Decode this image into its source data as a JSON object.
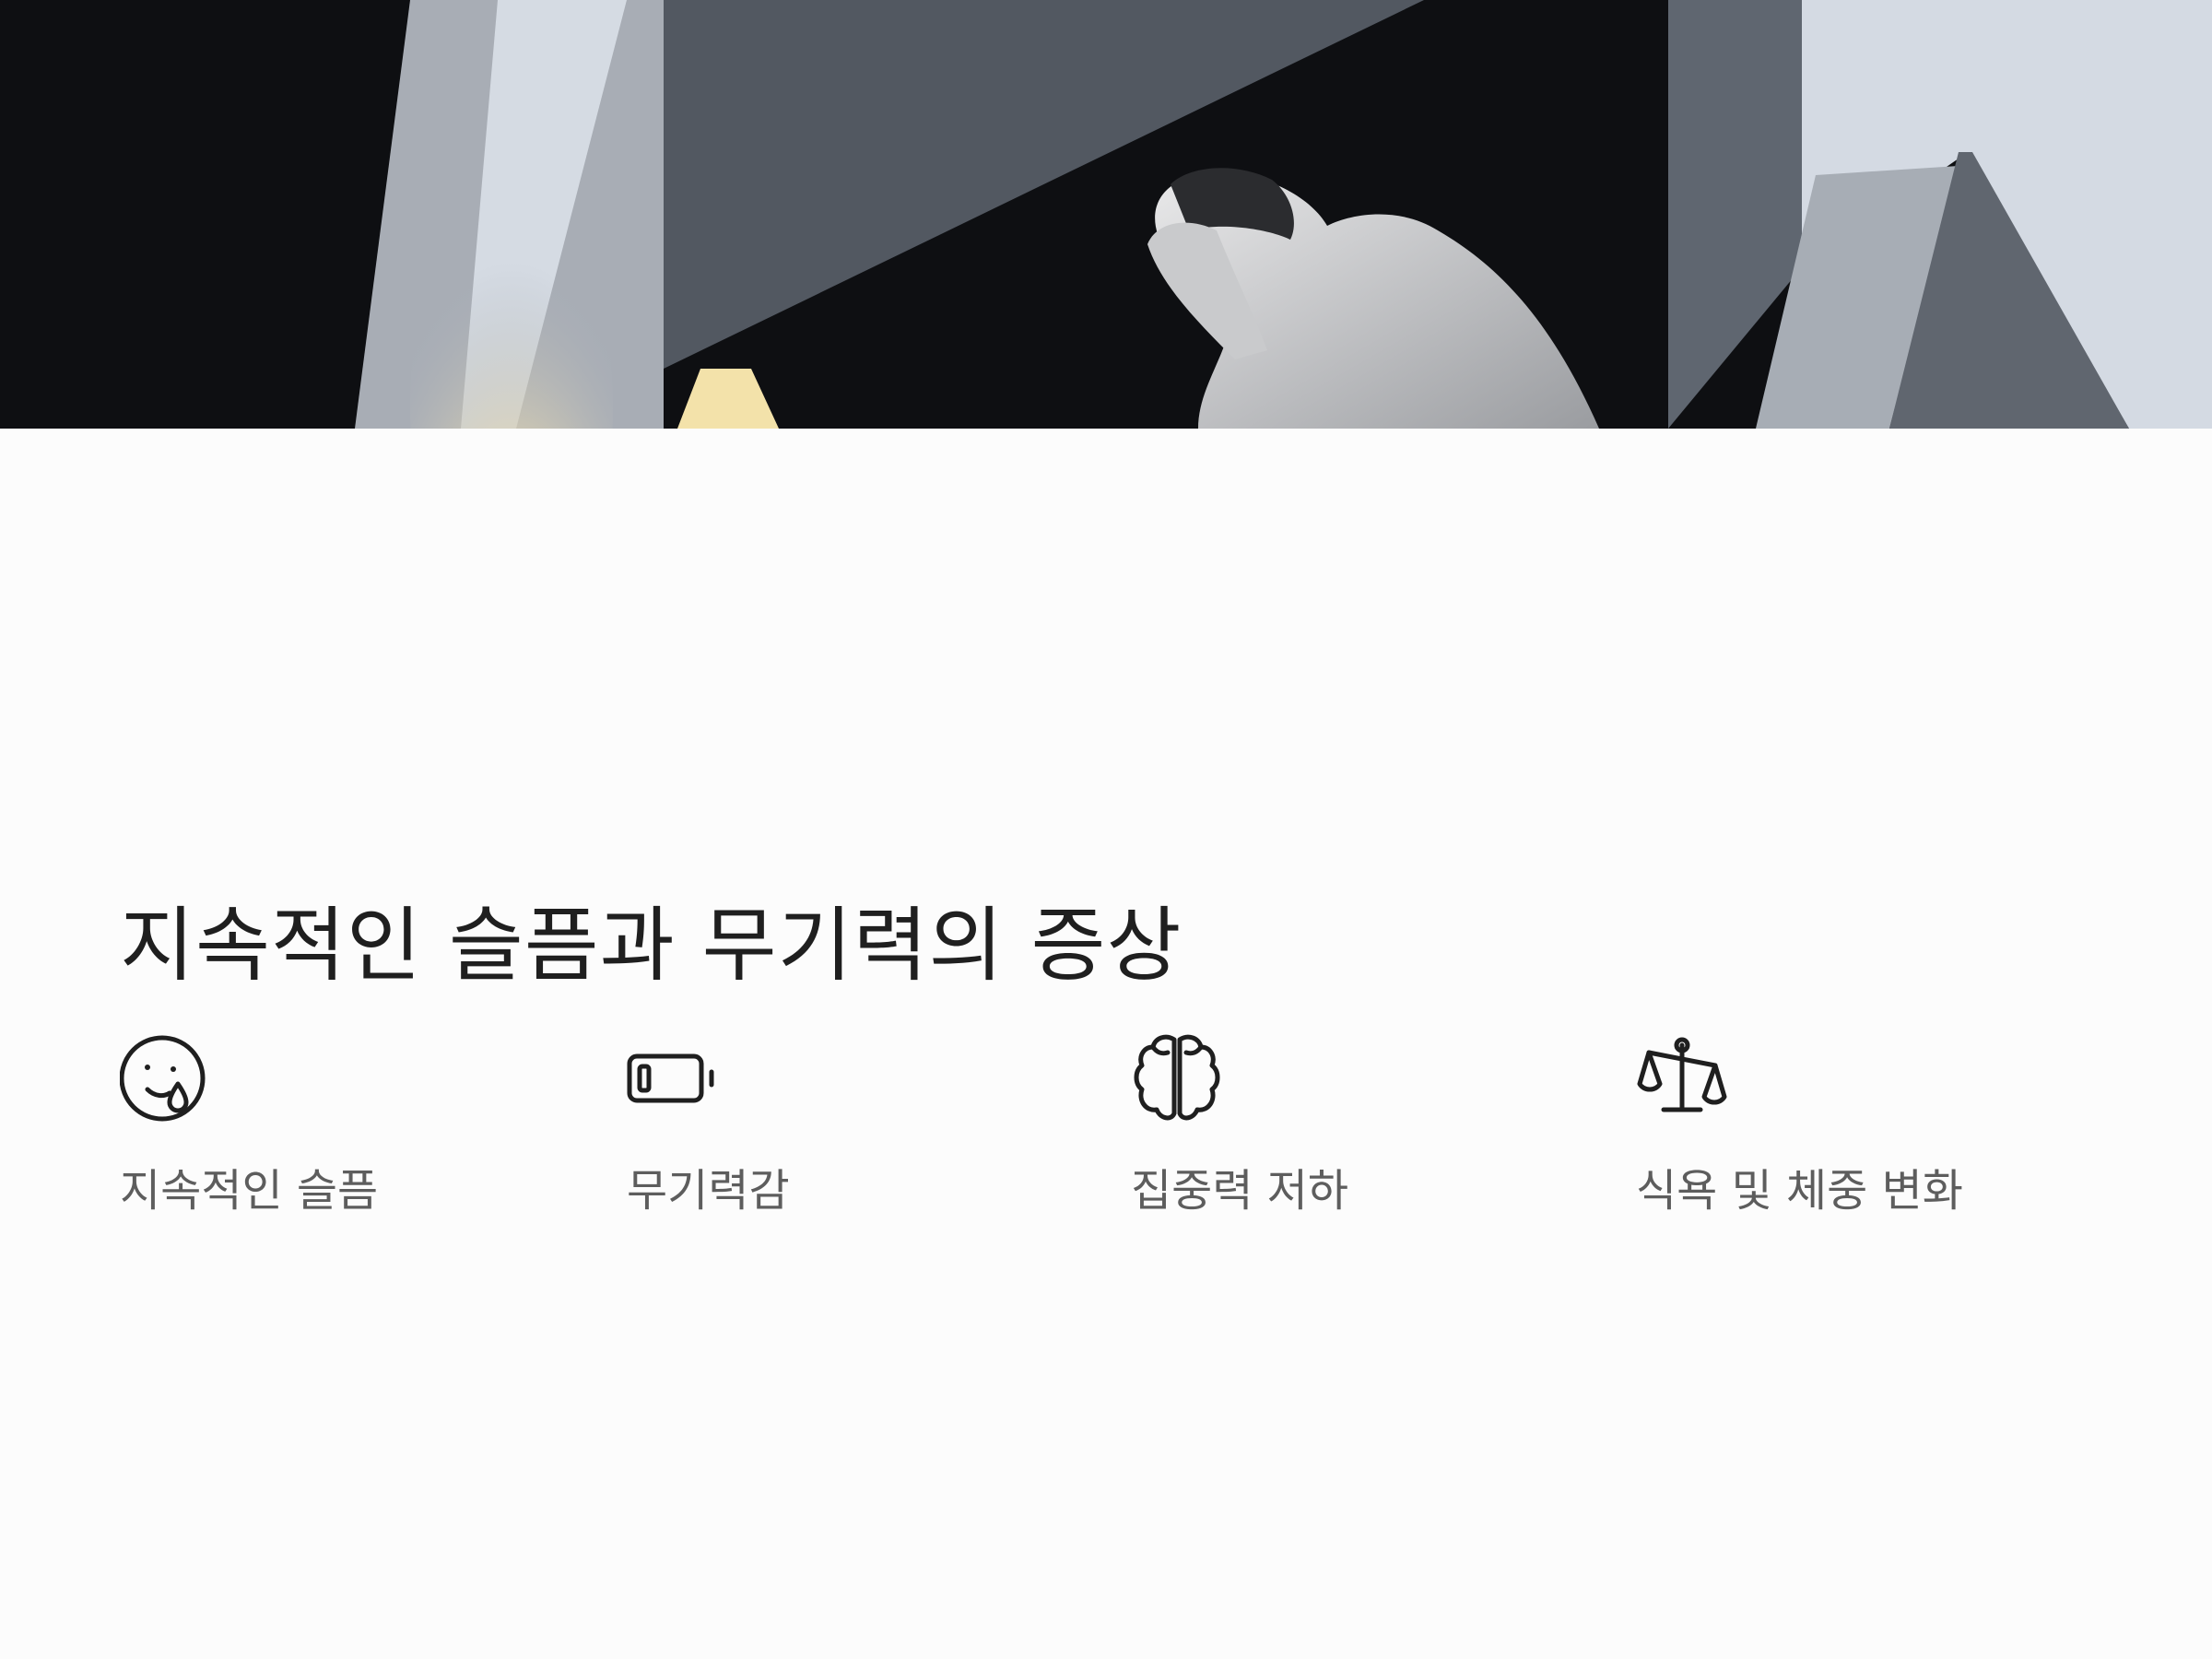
{
  "banner": {
    "icon": "person-in-distress-illustration"
  },
  "section": {
    "title": "지속적인 슬픔과 무기력의 증상"
  },
  "symptoms": [
    {
      "label": "지속적인 슬픔",
      "icon": "crying-face-icon"
    },
    {
      "label": "무기력감",
      "icon": "low-battery-icon"
    },
    {
      "label": "집중력 저하",
      "icon": "brain-icon"
    },
    {
      "label": "식욕 및 체중 변화",
      "icon": "balance-scale-icon"
    }
  ],
  "colors": {
    "text": "#1f1f1f",
    "label": "#5d5d5d",
    "background": "#fcfcfc"
  }
}
